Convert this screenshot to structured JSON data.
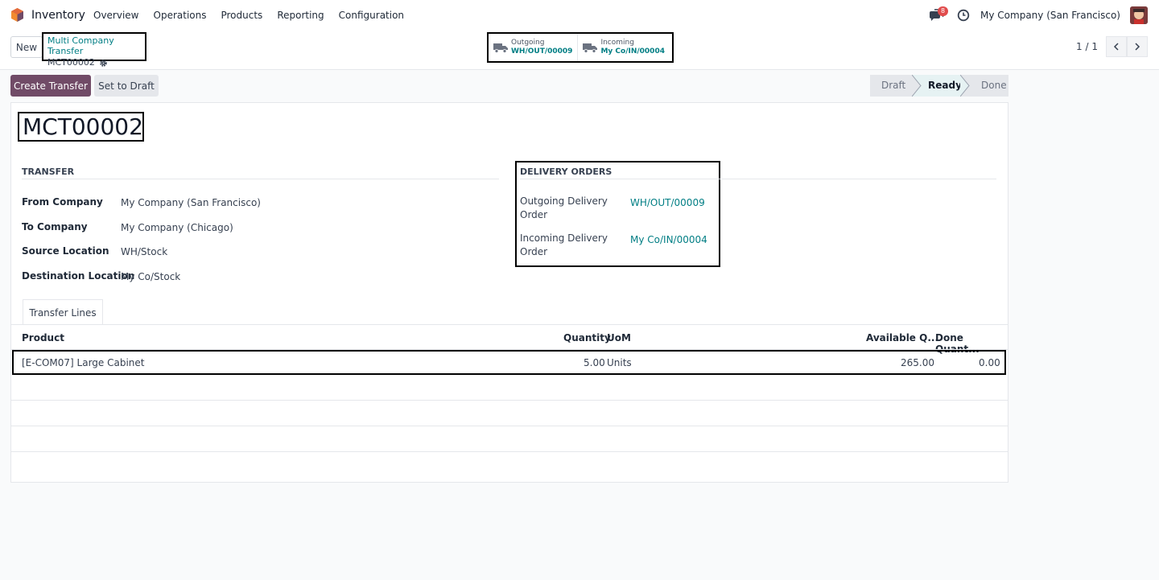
{
  "navbar": {
    "app_name": "Inventory",
    "menu": [
      "Overview",
      "Operations",
      "Products",
      "Reporting",
      "Configuration"
    ],
    "chat_badge": "8",
    "company": "My Company (San Francisco)"
  },
  "control": {
    "new_label": "New",
    "breadcrumb_parent": "Multi Company Transfer",
    "breadcrumb_current": "MCT00002",
    "smart_buttons": [
      {
        "label": "Outgoing",
        "value": "WH/OUT/00009"
      },
      {
        "label": "Incoming",
        "value": "My Co/IN/00004"
      }
    ],
    "pager": "1 / 1"
  },
  "status": {
    "create_transfer": "Create Transfer",
    "set_to_draft": "Set to Draft",
    "steps": [
      "Draft",
      "Ready",
      "Done"
    ],
    "active_step": "Ready"
  },
  "form": {
    "title": "MCT00002",
    "transfer_section": "TRANSFER",
    "fields": [
      {
        "label": "From Company",
        "value": "My Company (San Francisco)"
      },
      {
        "label": "To Company",
        "value": "My Company (Chicago)"
      },
      {
        "label": "Source Location",
        "value": "WH/Stock"
      },
      {
        "label": "Destination Location",
        "value": "My Co/Stock"
      }
    ],
    "delivery_section": "DELIVERY ORDERS",
    "delivery_fields": [
      {
        "label": "Outgoing Delivery Order",
        "value": "WH/OUT/00009"
      },
      {
        "label": "Incoming Delivery Order",
        "value": "My Co/IN/00004"
      }
    ]
  },
  "lines": {
    "tab": "Transfer Lines",
    "headers": [
      "Product",
      "Quantity",
      "UoM",
      "Available Q...",
      "Done Quant..."
    ],
    "rows": [
      {
        "product": "[E-COM07] Large Cabinet",
        "quantity": "5.00",
        "uom": "Units",
        "available": "265.00",
        "done": "0.00"
      }
    ]
  },
  "colors": {
    "primary": "#714b67",
    "link": "#017e84"
  }
}
